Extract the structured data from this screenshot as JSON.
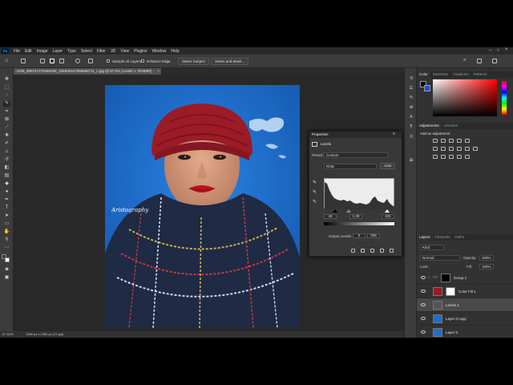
{
  "menubar": {
    "app_badge": "Ps",
    "items": [
      "File",
      "Edit",
      "Image",
      "Layer",
      "Type",
      "Select",
      "Filter",
      "3D",
      "View",
      "Plugins",
      "Window",
      "Help"
    ]
  },
  "options": {
    "sample_all_layers": "Sample All Layers",
    "enhance_edge": "Enhance Edge",
    "select_subject": "Select Subject",
    "select_and_mask": "Select and Mask..."
  },
  "document": {
    "tab_title": "-4226_889747270366290_155835167956699711_n.jpg @ 67.5% (Levels 1, RGB/8#)",
    "tab_close": "×",
    "watermark": "Aristography"
  },
  "status": {
    "zoom": "67.52%",
    "doc_info": "1080 px x 1350 px (72 ppi)"
  },
  "panels": {
    "color_tabs": [
      "Color",
      "Swatches",
      "Gradients",
      "Patterns"
    ],
    "adjust_tabs": [
      "Adjustments",
      "Libraries"
    ],
    "add_adjustment": "Add an adjustment",
    "layers_tabs": [
      "Layers",
      "Channels",
      "Paths"
    ],
    "kind": "Kind",
    "blend_mode": "Normal",
    "opacity_label": "Opacity:",
    "opacity_value": "100%",
    "lock_label": "Lock:",
    "fill_label": "Fill:",
    "fill_value": "100%",
    "layers": [
      {
        "name": "Group 1"
      },
      {
        "name": "Color Fill 1"
      },
      {
        "name": "Levels 1"
      },
      {
        "name": "Layer 0 copy"
      },
      {
        "name": "Layer 0"
      }
    ]
  },
  "properties": {
    "title": "Properties",
    "subtitle": "Levels",
    "preset_label": "Preset:",
    "preset_value": "Custom",
    "channel": "RGB",
    "auto": "Auto",
    "input_black": "40",
    "input_gamma": "1.39",
    "input_white": "231",
    "output_label": "Output Levels:",
    "output_black": "0",
    "output_white": "255"
  },
  "colors": {
    "fg": "#000000",
    "bg": "#ffffff",
    "accent": "#31a8ff",
    "backdrop_blue": "#1d6fc9",
    "hat_red": "#9b1b27",
    "scarf_navy": "#1f2a44"
  }
}
